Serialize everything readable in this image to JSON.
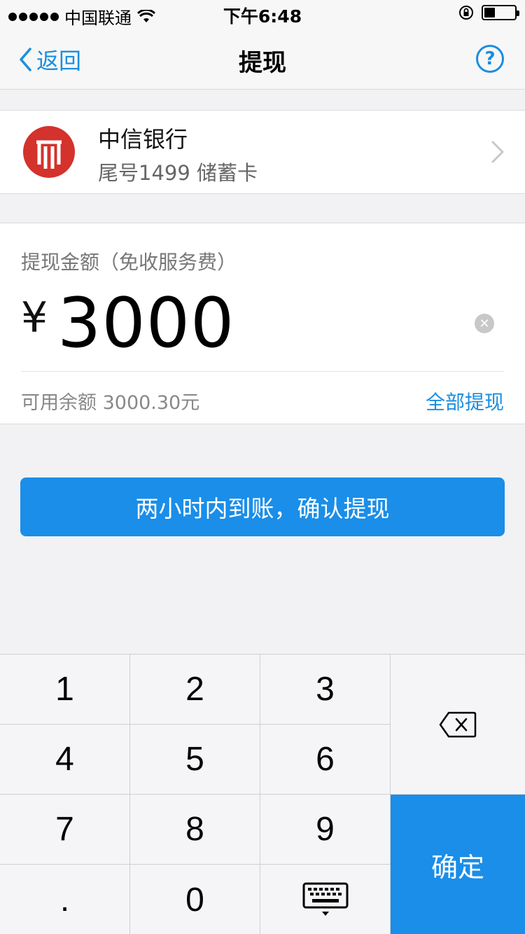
{
  "status_bar": {
    "carrier": "中国联通",
    "time": "下午6:48",
    "battery_level": 0.35
  },
  "nav": {
    "back_label": "返回",
    "title": "提现",
    "help_label": "?"
  },
  "bank": {
    "logo_color": "#d4322c",
    "name": "中信银行",
    "card": "尾号1499 储蓄卡"
  },
  "amount": {
    "label": "提现金额（免收服务费）",
    "currency": "¥",
    "value": "3000",
    "clear_label": "✕",
    "available": "可用余额 3000.30元",
    "withdraw_all": "全部提现"
  },
  "confirm_button": "两小时内到账，确认提现",
  "keypad": {
    "keys": [
      "1",
      "2",
      "3",
      "4",
      "5",
      "6",
      "7",
      "8",
      "9",
      ".",
      "0"
    ],
    "ok_label": "确定",
    "icons": [
      "backspace-icon",
      "keyboard-hide-icon"
    ]
  },
  "colors": {
    "accent": "#1a8ee8",
    "link": "#1a8ee0",
    "background": "#f2f2f4"
  }
}
